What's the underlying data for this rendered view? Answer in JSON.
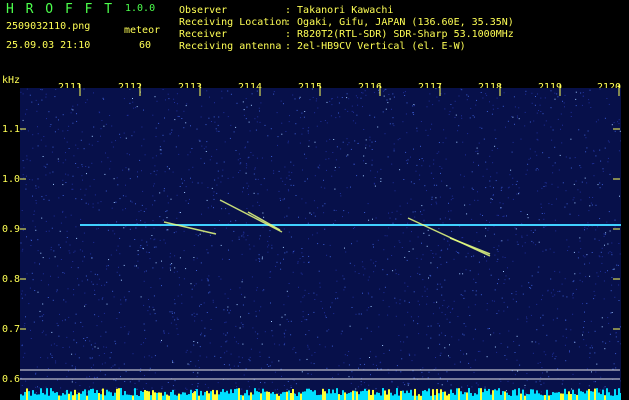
{
  "header": {
    "app_name": "H R O F F T",
    "version": "1.0.0",
    "filename": "2509032110.png",
    "mode": "meteor",
    "datetime": "25.09.03 21:10",
    "count": "60",
    "info": [
      {
        "label": "Observer",
        "value": ": Takanori Kawachi"
      },
      {
        "label": "Receiving Location",
        "value": ": Ogaki, Gifu, JAPAN (136.60E, 35.35N)"
      },
      {
        "label": "Receiver",
        "value": ": R820T2(RTL-SDR) SDR-Sharp 53.1000MHz"
      },
      {
        "label": "Receiving antenna",
        "value": ": 2el-HB9CV Vertical (el. E-W)"
      }
    ]
  },
  "axis": {
    "unit": "kHz",
    "x_ticks": [
      "2111",
      "2112",
      "2113",
      "2114",
      "2115",
      "2116",
      "2117",
      "2118",
      "2119",
      "2120"
    ],
    "y_ticks": [
      "1.1",
      "1.0",
      "0.9",
      "0.8",
      "0.7",
      "0.6"
    ]
  },
  "colors": {
    "background": "#07104a",
    "text_green": "#4cff4c",
    "text_yellow": "#ffff55",
    "carrier": "#40d0ff",
    "meteor": "#e8ff80"
  }
}
